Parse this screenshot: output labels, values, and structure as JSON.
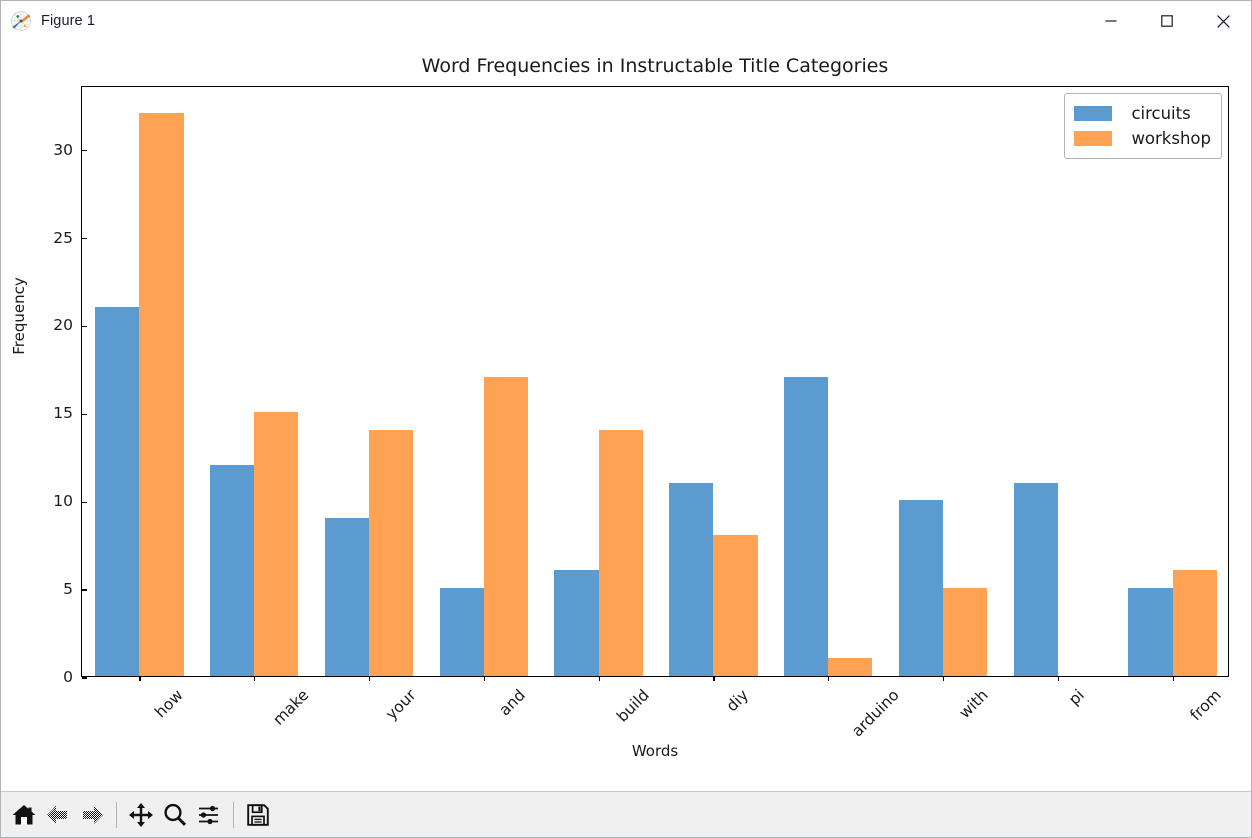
{
  "window": {
    "title": "Figure 1",
    "icon": "matplotlib-icon",
    "controls": {
      "minimize": "minimize-icon",
      "maximize": "maximize-icon",
      "close": "close-icon"
    }
  },
  "toolbar": {
    "buttons": [
      {
        "name": "home-button",
        "icon": "home-icon",
        "enabled": true
      },
      {
        "name": "back-button",
        "icon": "back-arrow-icon",
        "enabled": false
      },
      {
        "name": "forward-button",
        "icon": "forward-arrow-icon",
        "enabled": false
      },
      {
        "name": "separator-1",
        "icon": "separator",
        "enabled": false
      },
      {
        "name": "pan-button",
        "icon": "pan-move-icon",
        "enabled": true
      },
      {
        "name": "zoom-button",
        "icon": "magnifier-icon",
        "enabled": true
      },
      {
        "name": "configure-subplots-button",
        "icon": "sliders-icon",
        "enabled": true
      },
      {
        "name": "separator-2",
        "icon": "separator",
        "enabled": false
      },
      {
        "name": "save-button",
        "icon": "floppy-disk-icon",
        "enabled": true
      }
    ]
  },
  "colors": {
    "circuits": "#5b9bd0",
    "workshop": "#ffa253",
    "axes_line": "#000000",
    "text": "#1a1a1a",
    "toolbar_bg": "#f0f0f0",
    "window_bg": "#ffffff"
  },
  "chart_data": {
    "type": "bar",
    "title": "Word Frequencies in Instructable Title Categories",
    "xlabel": "Words",
    "ylabel": "Frequency",
    "categories": [
      "how",
      "make",
      "your",
      "and",
      "build",
      "diy",
      "arduino",
      "with",
      "pi",
      "from"
    ],
    "series": [
      {
        "name": "circuits",
        "color": "#5b9bd0",
        "values": [
          21,
          12,
          9,
          5,
          6,
          11,
          17,
          10,
          11,
          5
        ]
      },
      {
        "name": "workshop",
        "color": "#ffa253",
        "values": [
          32,
          15,
          14,
          17,
          14,
          8,
          1,
          5,
          0,
          6
        ]
      }
    ],
    "ylim": [
      0,
      33.6
    ],
    "yticks": [
      0,
      5,
      10,
      15,
      20,
      25,
      30
    ],
    "ytick_labels": [
      "0",
      "5",
      "10",
      "15",
      "20",
      "25",
      "30"
    ],
    "grid": false,
    "legend_position": "upper right",
    "xtick_rotation": -45
  }
}
